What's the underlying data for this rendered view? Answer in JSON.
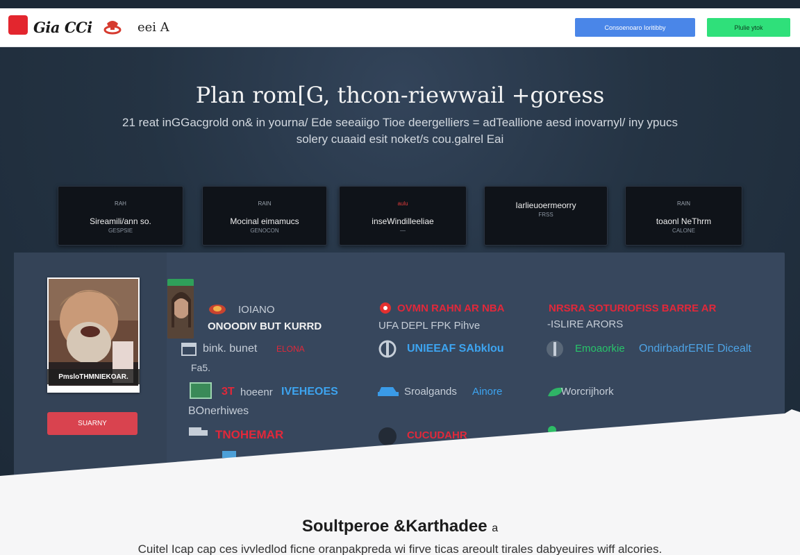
{
  "header": {
    "logo_text": "Gia CCi",
    "logo_sub": "eei A",
    "btn_primary": "Consoenoaro   Ioritibby",
    "btn_secondary": "Plulie ytok"
  },
  "hero": {
    "title": "Plan rom[G, thcon-riewwail +goress",
    "subtitle_line1": "21  reat inGGacgrold on&  in yourna/ Ede seeaiigo Tioe deergelliers = adTeallione aesd inovarnyl/ iny ypucs",
    "subtitle_line2": "solery cuaaid esit noket/s cou.galrel Eai"
  },
  "categories": [
    {
      "tiny": "RAH",
      "name": "Sireamili/ann so.",
      "meta": "GESPSIE"
    },
    {
      "tiny": "RAIN",
      "name": "Mocinal eimamucs",
      "meta": "GENOCON"
    },
    {
      "tiny": "aulu",
      "name": "inseWindilleeliae",
      "meta": "—"
    },
    {
      "tiny": "",
      "name": "Iarlieuoermeorry",
      "meta": "FRSS"
    },
    {
      "tiny": "RAIN",
      "name": "toaonl NeThrm",
      "meta": "CALONE"
    }
  ],
  "profile": {
    "caption": "PmsloTHMNIEKOAR.",
    "button": "SUARNY"
  },
  "listing": {
    "c1_r1": "IOIANO",
    "c1_r2": "ONOODIV BUT KURRD",
    "c1_r3_a": "bink. bunet",
    "c1_r3_b": "ELONA",
    "c1_r4": "Fa5.",
    "c1_r5_a": "3T",
    "c1_r5_b": "hoeenr",
    "c1_r5_c": "IVEHEOES",
    "c1_r6": "BOnerhiwes",
    "c1_r7": "TNOHEMAR",
    "c2_r1": "OVMN RAHN AR NBA",
    "c2_r2": "UFA   DEPL   FPK Pihve",
    "c2_r3": "UNIEEAF SAbklou",
    "c2_r4_a": "Sroalgands",
    "c2_r4_b": "Ainore",
    "c2_r5": "CUCUDAHR",
    "c3_r1": "NRSRA SOTURIOFISS BARRE AR",
    "c3_r2": "-ISLIRE ARORS",
    "c3_r3_a": "Emoaorkie",
    "c3_r3_b": "OndirbadrERIE Dicealt",
    "c3_r4": "Worcrijhork"
  },
  "footer": {
    "title": "Soultperoe &Karthadee",
    "title_mark": "a",
    "subtitle": "Cuitel Icap cap ces ivvledlod ficne oranpakpreda wi firve ticas areoult tirales dabyeuires wiff alcories."
  },
  "colors": {
    "accent_red": "#e3262e",
    "accent_blue": "#4a86e8",
    "accent_green": "#2fe07a",
    "hero_bg": "#243343"
  }
}
